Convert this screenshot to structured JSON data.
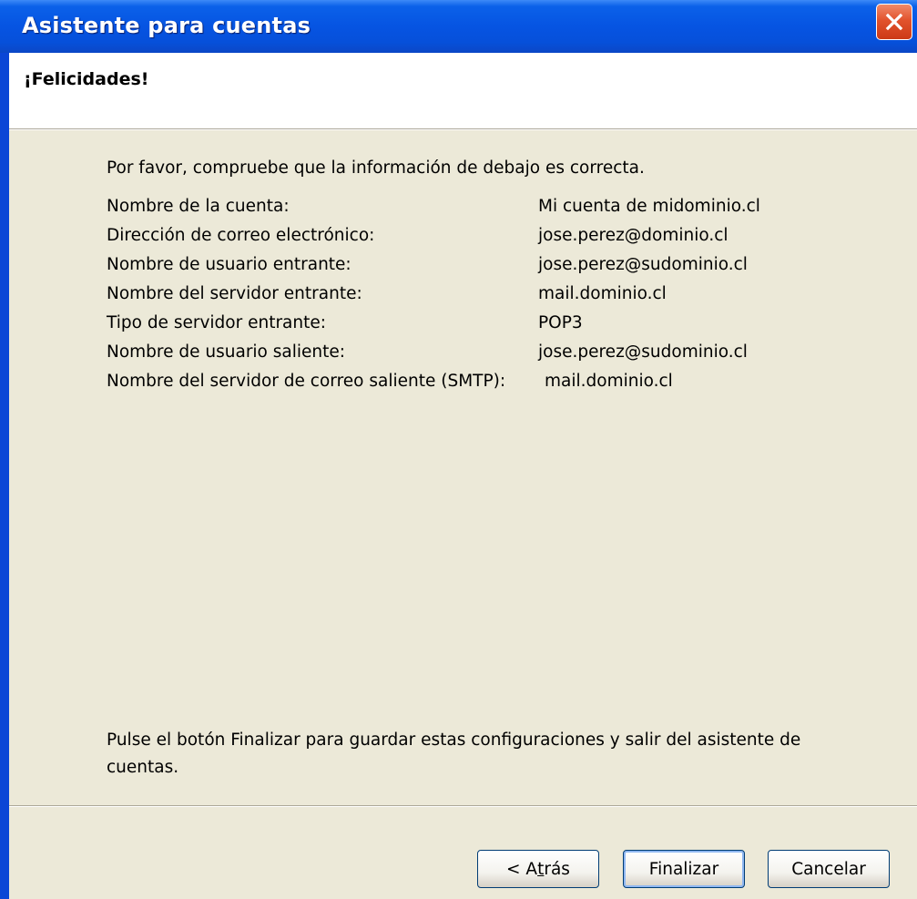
{
  "window": {
    "title": "Asistente para cuentas",
    "close_icon": "close-icon"
  },
  "header": {
    "title": "¡Felicidades!"
  },
  "intro": "Por favor, compruebe que la información de debajo es correcta.",
  "summary": [
    {
      "label": "Nombre de la cuenta:",
      "value": "Mi cuenta de midominio.cl"
    },
    {
      "label": "Dirección de correo electrónico:",
      "value": "jose.perez@dominio.cl"
    },
    {
      "label": "Nombre de usuario entrante:",
      "value": "jose.perez@sudominio.cl"
    },
    {
      "label": "Nombre del servidor entrante:",
      "value": "mail.dominio.cl"
    },
    {
      "label": "Tipo de servidor entrante:",
      "value": "POP3"
    },
    {
      "label": "Nombre de usuario saliente:",
      "value": "jose.perez@sudominio.cl"
    },
    {
      "label": "Nombre del servidor de correo saliente (SMTP):",
      "value": "mail.dominio.cl"
    }
  ],
  "footer_note": "Pulse el botón Finalizar para guardar estas configuraciones y salir del asistente de cuentas.",
  "buttons": {
    "back_prefix": "< A",
    "back_mnemonic": "t",
    "back_suffix": "rás",
    "finish": "Finalizar",
    "cancel": "Cancelar"
  },
  "colors": {
    "titlebar": "#0654e2",
    "client_bg": "#ece9d8",
    "close_button": "#e2532d"
  }
}
